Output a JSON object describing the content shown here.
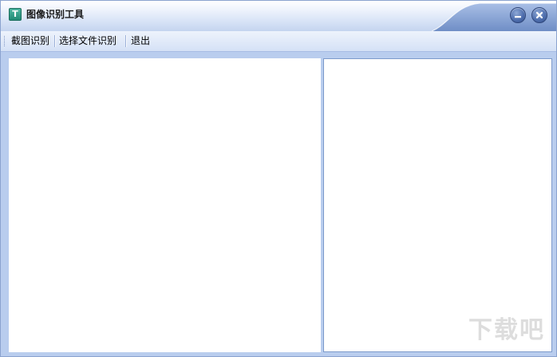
{
  "window": {
    "title": "图像识别工具",
    "icon_glyph": "T",
    "icon_name": "app-t-icon",
    "accent_color": "#4f6fae"
  },
  "title_buttons": {
    "minimize_icon": "minimize-icon",
    "close_icon": "close-icon"
  },
  "menu": {
    "items": [
      {
        "label": "截图识别"
      },
      {
        "label": "选择文件识别"
      },
      {
        "label": "退出"
      }
    ]
  },
  "watermark": {
    "text": "下载吧"
  }
}
